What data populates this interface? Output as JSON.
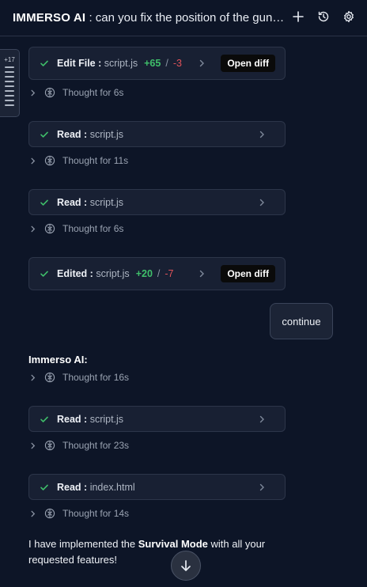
{
  "header": {
    "app_name": "IMMERSO AI",
    "separator": " : ",
    "conversation_title": "can you fix the position of the guns on the player in the game",
    "icons": [
      "plus-icon",
      "history-icon",
      "gear-icon"
    ]
  },
  "scroll_tab": {
    "count": "+17"
  },
  "timeline": {
    "card1": {
      "action": "Edit File",
      "sep": " : ",
      "file": "script.js",
      "added": "+65",
      "slash": "/",
      "removed": "-3",
      "button": "Open diff"
    },
    "thought1": "Thought for 6s",
    "card2": {
      "action": "Read",
      "sep": " : ",
      "file": "script.js"
    },
    "thought2": "Thought for 11s",
    "card3": {
      "action": "Read",
      "sep": " : ",
      "file": "script.js"
    },
    "thought3": "Thought for 6s",
    "card4": {
      "action": "Edited",
      "sep": " : ",
      "file": "script.js",
      "added": "+20",
      "slash": "/",
      "removed": "-7",
      "button": "Open diff"
    },
    "user_message": "continue",
    "ai_name": "Immerso AI:",
    "thought4": "Thought for 16s",
    "card5": {
      "action": "Read",
      "sep": " : ",
      "file": "script.js"
    },
    "thought5": "Thought for 23s",
    "card6": {
      "action": "Read",
      "sep": " : ",
      "file": "index.html"
    },
    "thought6": "Thought for 14s",
    "reply": {
      "pre": "I have implemented the ",
      "bold": "Survival Mode",
      "post": " with all your requested features!"
    }
  },
  "colors": {
    "background": "#0d1527",
    "card": "#182033",
    "added": "#3fbf6a",
    "removed": "#e0525a"
  }
}
